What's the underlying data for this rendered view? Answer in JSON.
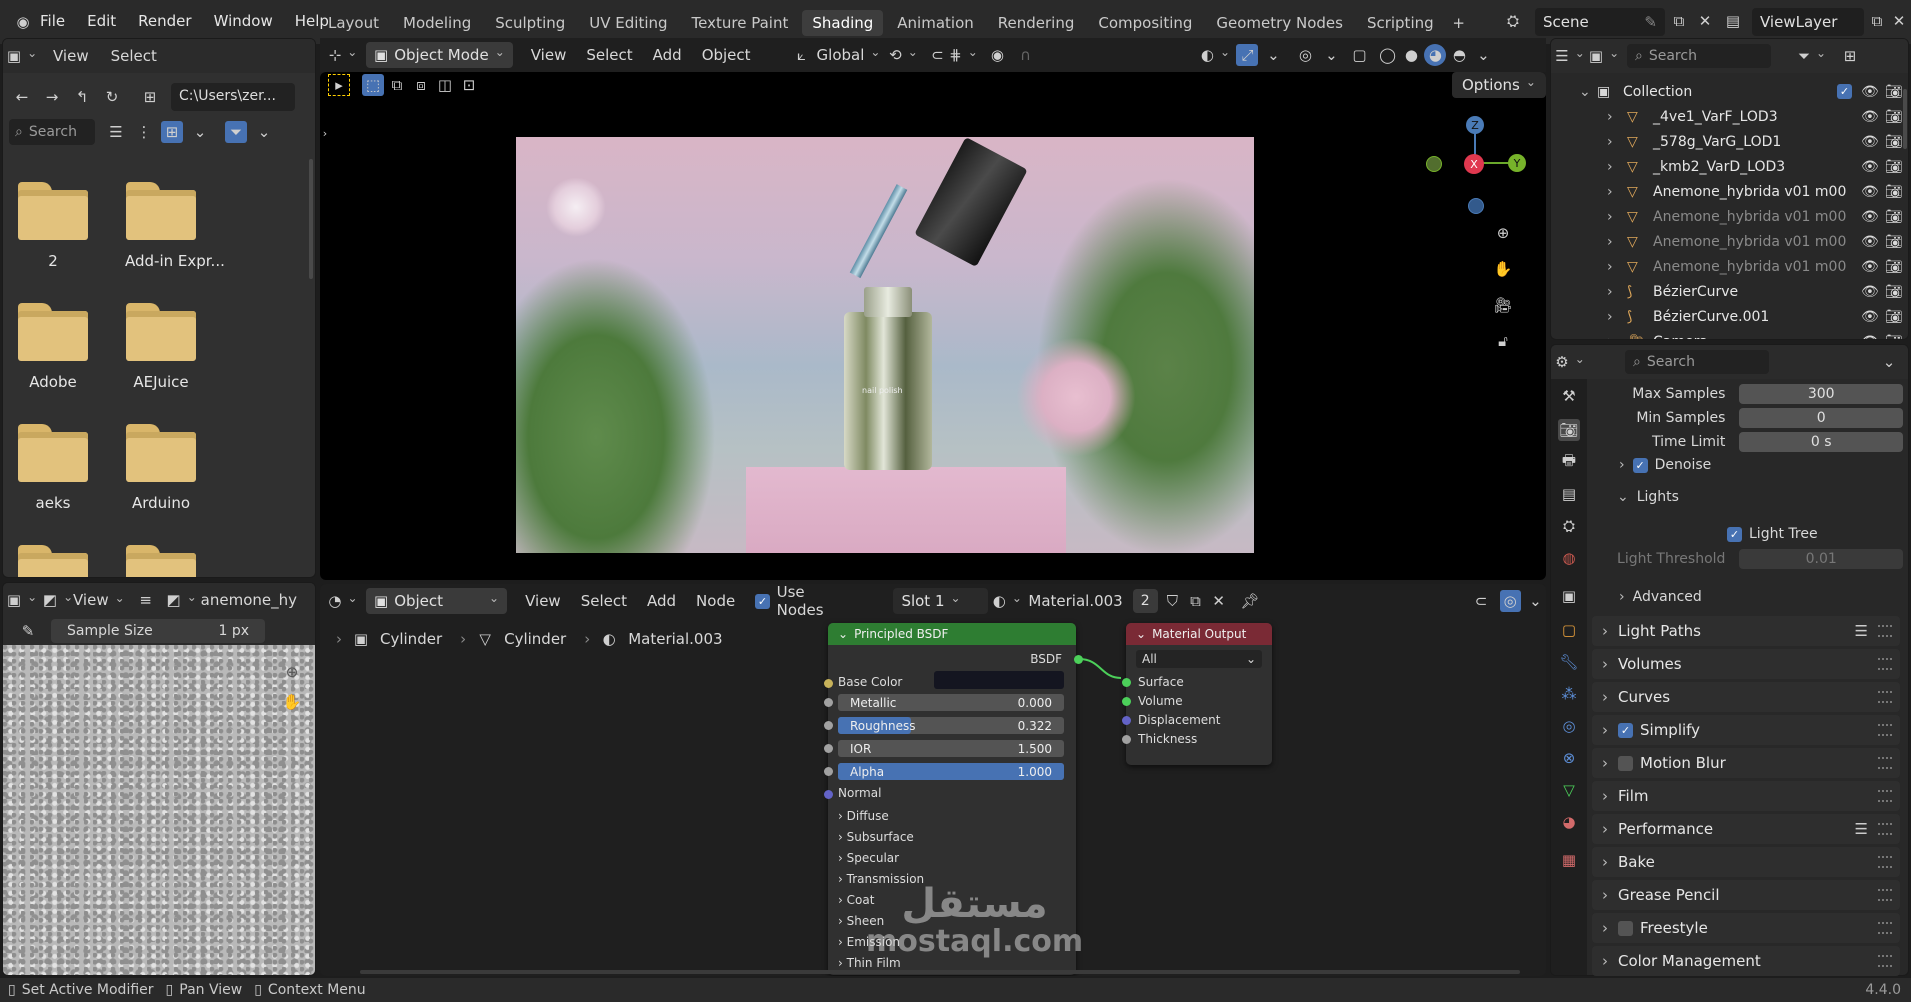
{
  "topbar": {
    "menus": [
      "File",
      "Edit",
      "Render",
      "Window",
      "Help"
    ],
    "workspaces": [
      "Layout",
      "Modeling",
      "Sculpting",
      "UV Editing",
      "Texture Paint",
      "Shading",
      "Animation",
      "Rendering",
      "Compositing",
      "Geometry Nodes",
      "Scripting"
    ],
    "active_workspace": "Shading",
    "scene": "Scene",
    "view_layer": "ViewLayer"
  },
  "file_browser": {
    "menus": [
      "View",
      "Select"
    ],
    "path": "C:\\Users\\zer...",
    "search_placeholder": "Search",
    "folders": [
      "2",
      "Add-in Expr...",
      "Adobe",
      "AEJuice",
      "aeks",
      "Arduino"
    ]
  },
  "image_editor": {
    "view_label": "View",
    "image_name": "anemone_hy",
    "sample_size_label": "Sample Size",
    "sample_size_value": "1 px"
  },
  "viewport": {
    "mode": "Object Mode",
    "menus": [
      "View",
      "Select",
      "Add",
      "Object"
    ],
    "transform": "Global",
    "options_label": "Options",
    "gizmo": {
      "z": "Z",
      "x": "X",
      "y": "Y"
    },
    "bottle_label": "nail polish"
  },
  "node_editor": {
    "object_mode": "Object",
    "menus": [
      "View",
      "Select",
      "Add",
      "Node"
    ],
    "use_nodes_label": "Use Nodes",
    "slot": "Slot 1",
    "material": "Material.003",
    "users": "2",
    "breadcrumb": [
      "Cylinder",
      "Cylinder",
      "Material.003"
    ],
    "bsdf": {
      "title": "Principled BSDF",
      "output": "BSDF",
      "base_color": "Base Color",
      "metallic": {
        "label": "Metallic",
        "value": "0.000"
      },
      "roughness": {
        "label": "Roughness",
        "value": "0.322",
        "fraction": 0.322
      },
      "ior": {
        "label": "IOR",
        "value": "1.500"
      },
      "alpha": {
        "label": "Alpha",
        "value": "1.000",
        "fraction": 1.0
      },
      "normal": "Normal",
      "panels": [
        "Diffuse",
        "Subsurface",
        "Specular",
        "Transmission",
        "Coat",
        "Sheen",
        "Emission",
        "Thin Film"
      ]
    },
    "output": {
      "title": "Material Output",
      "target": "All",
      "inputs": [
        "Surface",
        "Volume",
        "Displacement",
        "Thickness"
      ]
    }
  },
  "outliner": {
    "search_placeholder": "Search",
    "collection": "Collection",
    "items": [
      {
        "name": "_4ve1_VarF_LOD3",
        "type": "mesh",
        "dim": false
      },
      {
        "name": "_578g_VarG_LOD1",
        "type": "mesh",
        "dim": false
      },
      {
        "name": "_kmb2_VarD_LOD3",
        "type": "mesh",
        "dim": false
      },
      {
        "name": "Anemone_hybrida v01 m00",
        "type": "mesh",
        "dim": false
      },
      {
        "name": "Anemone_hybrida v01 m00",
        "type": "mesh",
        "dim": true
      },
      {
        "name": "Anemone_hybrida v01 m00",
        "type": "mesh",
        "dim": true
      },
      {
        "name": "Anemone_hybrida v01 m00",
        "type": "mesh",
        "dim": true
      },
      {
        "name": "BézierCurve",
        "type": "curve",
        "dim": false
      },
      {
        "name": "BézierCurve.001",
        "type": "curve",
        "dim": false
      },
      {
        "name": "Camera",
        "type": "camera",
        "dim": false
      }
    ]
  },
  "properties": {
    "search_placeholder": "Search",
    "max_samples": {
      "label": "Max Samples",
      "value": "300"
    },
    "min_samples": {
      "label": "Min Samples",
      "value": "0"
    },
    "time_limit": {
      "label": "Time Limit",
      "value": "0 s"
    },
    "denoise": "Denoise",
    "lights": "Lights",
    "light_tree": "Light Tree",
    "light_threshold": {
      "label": "Light Threshold",
      "value": "0.01"
    },
    "advanced": "Advanced",
    "sections": [
      {
        "label": "Light Paths",
        "checkbox": null,
        "list": true
      },
      {
        "label": "Volumes",
        "checkbox": null,
        "list": false
      },
      {
        "label": "Curves",
        "checkbox": null,
        "list": false
      },
      {
        "label": "Simplify",
        "checkbox": true,
        "list": false
      },
      {
        "label": "Motion Blur",
        "checkbox": false,
        "list": false
      },
      {
        "label": "Film",
        "checkbox": null,
        "list": false
      },
      {
        "label": "Performance",
        "checkbox": null,
        "list": true
      },
      {
        "label": "Bake",
        "checkbox": null,
        "list": false
      },
      {
        "label": "Grease Pencil",
        "checkbox": null,
        "list": false
      },
      {
        "label": "Freestyle",
        "checkbox": false,
        "list": false
      },
      {
        "label": "Color Management",
        "checkbox": null,
        "list": false
      }
    ]
  },
  "statusbar": {
    "items": [
      "Set Active Modifier",
      "Pan View",
      "Context Menu"
    ],
    "version": "4.4.0"
  },
  "watermark": {
    "arabic": "مستقل",
    "latin": "mostaql.com"
  },
  "colors": {
    "accent": "#4772b3",
    "bsdf_header": "#2e7d32",
    "output_header": "#7a2a35",
    "background": "#1d1d1d"
  }
}
